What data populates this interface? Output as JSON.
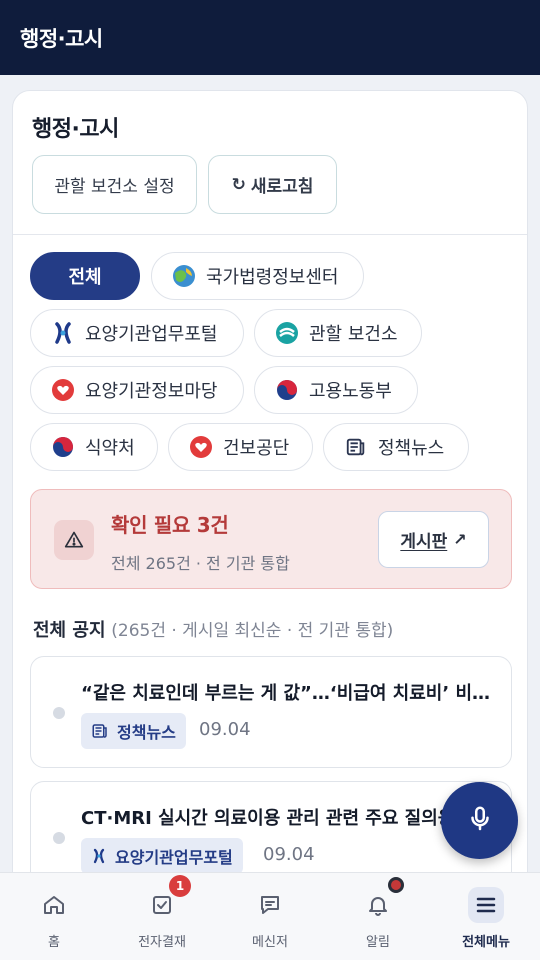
{
  "appbar": {
    "title": "행정·고시"
  },
  "card": {
    "title": "행정·고시",
    "region_button": "관할 보건소 설정",
    "refresh_button": "새로고침"
  },
  "filters": [
    {
      "label": "전체",
      "icon": "none",
      "selected": true
    },
    {
      "label": "국가법령정보센터",
      "icon": "globe-icon"
    },
    {
      "label": "요양기관업무포털",
      "icon": "hira-logo-icon"
    },
    {
      "label": "관할 보건소",
      "icon": "health-center-logo-icon"
    },
    {
      "label": "요양기관정보마당",
      "icon": "nhis-heart-icon"
    },
    {
      "label": "고용노동부",
      "icon": "taegeuk-icon"
    },
    {
      "label": "식약처",
      "icon": "taegeuk-icon"
    },
    {
      "label": "건보공단",
      "icon": "nhis-heart-icon"
    },
    {
      "label": "정책뉴스",
      "icon": "newspaper-icon"
    }
  ],
  "alert": {
    "title": "확인 필요 3건",
    "subtitle": "전체 265건 · 전 기관 통합",
    "board_button": "게시판",
    "board_arrow": "↗"
  },
  "notices_header": {
    "title": "전체 공지",
    "meta": "(265건 · 게시일 최신순 · 전 기관 통합)"
  },
  "notices": [
    {
      "title": "“같은 치료인데 부르는 게 값”…‘비급여 치료비’ 비교 공개",
      "source": "정책뉴스",
      "source_icon": "newspaper-icon",
      "date": "09.04"
    },
    {
      "title": "CT·MRI 실시간 의료이용 관리 관련 주요 질의응답",
      "source": "요양기관업무포털",
      "source_icon": "hira-logo-icon",
      "date": "09.04"
    }
  ],
  "bottom_nav": [
    {
      "label": "홈",
      "icon": "home-icon"
    },
    {
      "label": "전자결재",
      "icon": "approval-icon",
      "badge": "1"
    },
    {
      "label": "메신저",
      "icon": "chat-icon"
    },
    {
      "label": "알림",
      "icon": "bell-icon"
    },
    {
      "label": "전체메뉴",
      "icon": "menu-icon",
      "active": true
    }
  ],
  "colors": {
    "appbar": "#0f1c3c",
    "accent": "#243c86",
    "alert_bg": "#f8e8e8",
    "alert_text": "#b43a3a",
    "badge": "#d93d3d"
  }
}
